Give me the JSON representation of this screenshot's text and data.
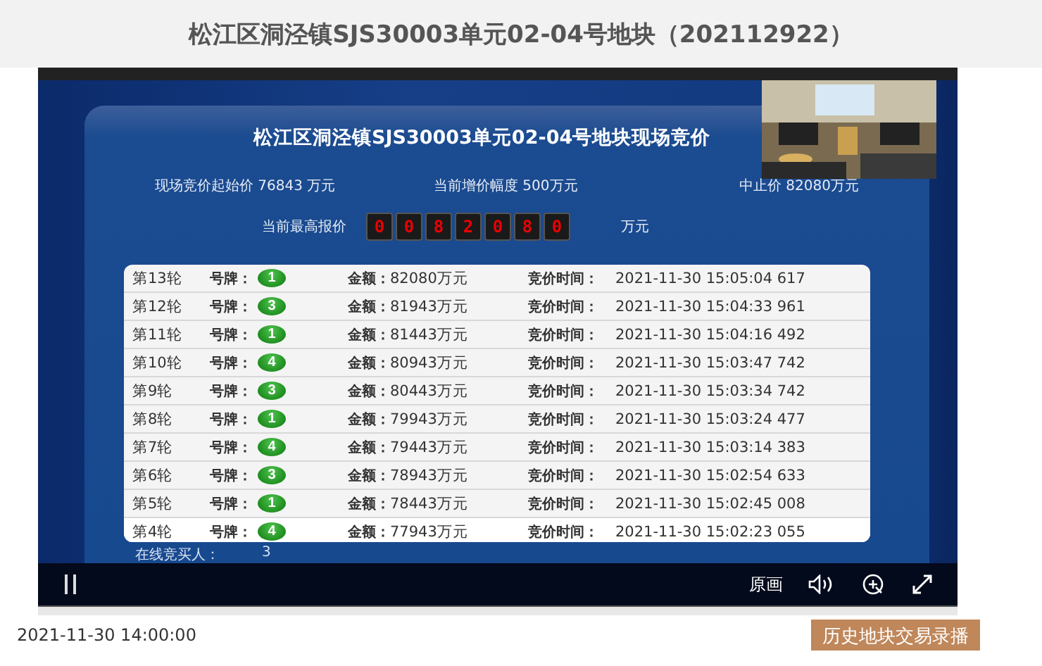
{
  "page_title": "松江区洞泾镇SJS30003单元02-04号地块（202112922）",
  "auction": {
    "title": "松江区洞泾镇SJS30003单元02-04号地块现场竞价",
    "info": [
      "现场竞价起始价 76843 万元",
      "当前增价幅度 500万元",
      "中止价 82080万元"
    ],
    "highest_label": "当前最高报价",
    "highest_digits": [
      "0",
      "0",
      "8",
      "2",
      "0",
      "8",
      "0"
    ],
    "highest_unit": "万元",
    "bids": [
      {
        "round": "第13轮",
        "plate_label": "号牌：",
        "plate": "1",
        "amount_label": "金额：",
        "amount": "82080万元",
        "time_label": "竞价时间：",
        "time": "2021-11-30 15:05:04 617"
      },
      {
        "round": "第12轮",
        "plate_label": "号牌：",
        "plate": "3",
        "amount_label": "金额：",
        "amount": "81943万元",
        "time_label": "竞价时间：",
        "time": "2021-11-30 15:04:33 961"
      },
      {
        "round": "第11轮",
        "plate_label": "号牌：",
        "plate": "1",
        "amount_label": "金额：",
        "amount": "81443万元",
        "time_label": "竞价时间：",
        "time": "2021-11-30 15:04:16 492"
      },
      {
        "round": "第10轮",
        "plate_label": "号牌：",
        "plate": "4",
        "amount_label": "金额：",
        "amount": "80943万元",
        "time_label": "竞价时间：",
        "time": "2021-11-30 15:03:47 742"
      },
      {
        "round": "第9轮",
        "plate_label": "号牌：",
        "plate": "3",
        "amount_label": "金额：",
        "amount": "80443万元",
        "time_label": "竞价时间：",
        "time": "2021-11-30 15:03:34 742"
      },
      {
        "round": "第8轮",
        "plate_label": "号牌：",
        "plate": "1",
        "amount_label": "金额：",
        "amount": "79943万元",
        "time_label": "竞价时间：",
        "time": "2021-11-30 15:03:24 477"
      },
      {
        "round": "第7轮",
        "plate_label": "号牌：",
        "plate": "4",
        "amount_label": "金额：",
        "amount": "79443万元",
        "time_label": "竞价时间：",
        "time": "2021-11-30 15:03:14 383"
      },
      {
        "round": "第6轮",
        "plate_label": "号牌：",
        "plate": "3",
        "amount_label": "金额：",
        "amount": "78943万元",
        "time_label": "竞价时间：",
        "time": "2021-11-30 15:02:54 633"
      },
      {
        "round": "第5轮",
        "plate_label": "号牌：",
        "plate": "1",
        "amount_label": "金额：",
        "amount": "78443万元",
        "time_label": "竞价时间：",
        "time": "2021-11-30 15:02:45 008"
      },
      {
        "round": "第4轮",
        "plate_label": "号牌：",
        "plate": "4",
        "amount_label": "金额：",
        "amount": "77943万元",
        "time_label": "竞价时间：",
        "time": "2021-11-30 15:02:23 055"
      }
    ],
    "online_label": "在线竞买人：",
    "online_count": "3"
  },
  "controls": {
    "quality": "原画"
  },
  "footer": {
    "date": "2021-11-30 14:00:00",
    "history_button": "历史地块交易录播"
  }
}
